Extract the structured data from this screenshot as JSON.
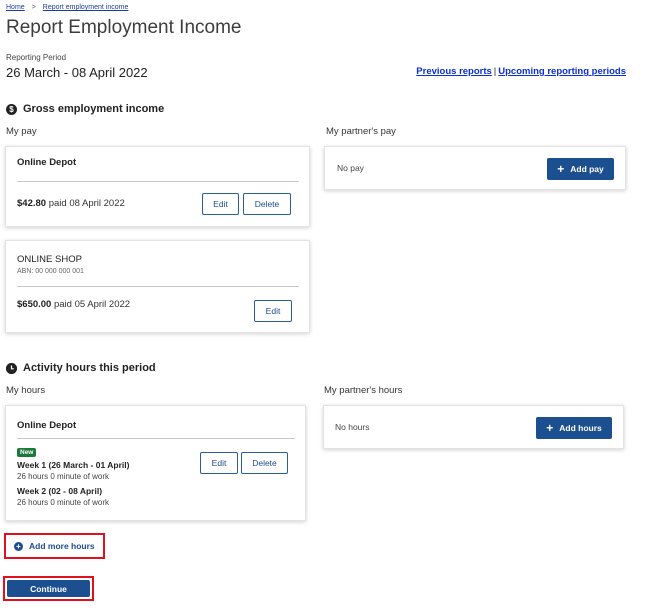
{
  "breadcrumb": {
    "home": "Home",
    "separator": ">",
    "current": "Report employment income"
  },
  "page_title": "Report Employment Income",
  "reporting_period": {
    "label": "Reporting Period",
    "value": "26 March - 08 April 2022"
  },
  "links": {
    "previous": "Previous reports",
    "divider": "|",
    "upcoming": "Upcoming reporting periods"
  },
  "gross_income": {
    "heading": "Gross employment income",
    "icon": "dollar-icon",
    "icon_glyph": "$",
    "my_pay_label": "My pay",
    "partner_pay_label": "My partner's pay",
    "my_pay_cards": [
      {
        "employer": "Online Depot",
        "amount": "$42.80",
        "paid_word": "paid",
        "date": "08 April 2022",
        "edit": "Edit",
        "delete": "Delete"
      },
      {
        "employer": "ONLINE SHOP",
        "abn": "ABN: 00 000 000 001",
        "amount": "$650.00",
        "paid_word": "paid",
        "date": "05 April 2022",
        "edit": "Edit"
      }
    ],
    "partner_card": {
      "text": "No pay",
      "button": "Add pay",
      "button_icon": "+"
    }
  },
  "activity": {
    "heading": "Activity hours this period",
    "icon": "clock-icon",
    "my_hours_label": "My hours",
    "partner_hours_label": "My partner's hours",
    "my_hours_card": {
      "employer": "Online Depot",
      "badge": "New",
      "weeks": [
        {
          "title": "Week 1 (26 March - 01 April)",
          "detail": "26 hours 0 minute of work"
        },
        {
          "title": "Week 2 (02 - 08 April)",
          "detail": "26 hours 0 minute of work"
        }
      ],
      "edit": "Edit",
      "delete": "Delete"
    },
    "partner_card": {
      "text": "No hours",
      "button": "Add hours",
      "button_icon": "+"
    },
    "add_more": {
      "label": "Add more hours",
      "icon": "plus-circle-icon",
      "icon_glyph": "+"
    }
  },
  "continue_label": "Continue",
  "colors": {
    "primary": "#1c4f8f",
    "highlight": "#e0101e",
    "new_badge": "#1b7a3a",
    "link": "#0b2ed6"
  }
}
